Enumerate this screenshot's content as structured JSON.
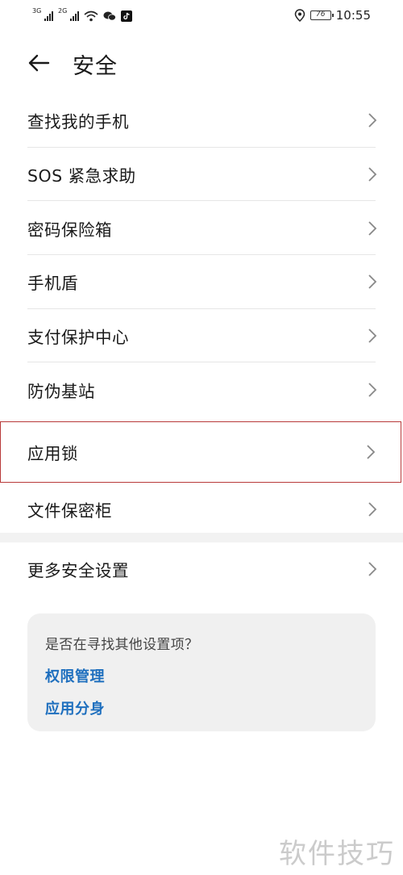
{
  "status_bar": {
    "net1": "3G",
    "net2": "2G",
    "battery": "76",
    "time": "10:55"
  },
  "header": {
    "title": "安全"
  },
  "list": [
    {
      "label": "查找我的手机"
    },
    {
      "label": "SOS 紧急求助"
    },
    {
      "label": "密码保险箱"
    },
    {
      "label": "手机盾"
    },
    {
      "label": "支付保护中心"
    },
    {
      "label": "防伪基站"
    },
    {
      "label": "应用锁"
    },
    {
      "label": "文件保密柜"
    }
  ],
  "more": {
    "label": "更多安全设置"
  },
  "suggestion": {
    "question": "是否在寻找其他设置项？",
    "links": [
      "权限管理",
      "应用分身"
    ]
  },
  "watermark": "软件技巧",
  "colors": {
    "link": "#1e6fbe",
    "highlight_border": "#b83a3a",
    "card_bg": "#f0f0f0"
  }
}
